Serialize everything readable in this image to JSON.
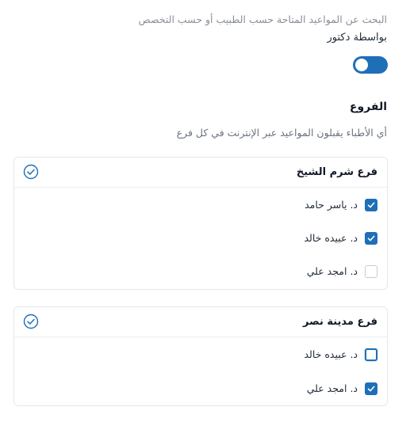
{
  "search": {
    "description": "البحث عن المواعيد المتاحة حسب الطبيب أو حسب التخصص",
    "mode_label": "بواسطة دكتور",
    "toggle_on": true
  },
  "branches": {
    "title": "الفروع",
    "subtitle": "أي الأطباء يقبلون المواعيد عبر الإنترنت في كل فرع",
    "items": [
      {
        "name": "فرع شرم الشيخ",
        "doctors": [
          {
            "name": "د. ياسر حامد",
            "checked": true
          },
          {
            "name": "د. عبيده خالد",
            "checked": true
          },
          {
            "name": "د. امجد علي",
            "checked": false
          }
        ]
      },
      {
        "name": "فرع مدينة نصر",
        "doctors": [
          {
            "name": "د. عبيده خالد",
            "checked": false
          },
          {
            "name": "د. امجد علي",
            "checked": true
          }
        ]
      }
    ]
  },
  "colors": {
    "accent": "#1f6fb8",
    "muted_text": "#8a8f98",
    "border": "#e5e7eb"
  }
}
